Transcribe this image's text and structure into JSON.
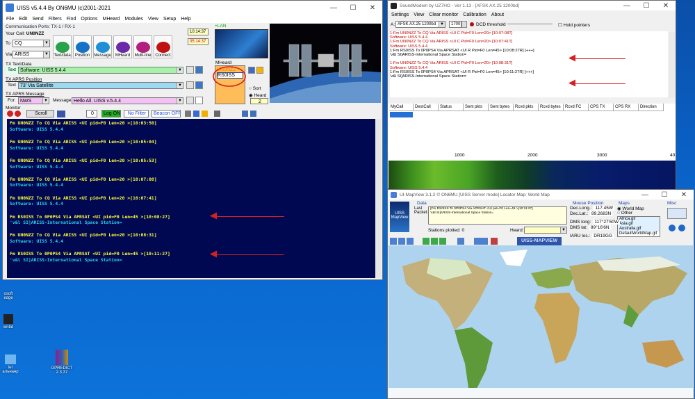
{
  "uiss": {
    "title": "UISS v5.4.4 By ON6MU (c)2001-2021",
    "menu": [
      "File",
      "Edit",
      "Send",
      "Filters",
      "Find",
      "Options",
      "MHeard",
      "Modules",
      "View",
      "Setup",
      "Help"
    ],
    "comm_ports": "Communication Ports: TX-1 / RX-1",
    "your_call_label": "Your Call:",
    "your_call": "UN0NZZ",
    "to_label": "To",
    "to_value": "CQ",
    "via_label": "Via",
    "via_value": "ARISS",
    "lan": "+LAN",
    "clock1": "10:14:37",
    "clock2": "05:14:37",
    "tool_buttons": [
      {
        "label": "Text/data",
        "icon": "text-data-icon",
        "color": "#2aa14b"
      },
      {
        "label": "Position",
        "icon": "position-icon",
        "color": "#1572c8"
      },
      {
        "label": "Message",
        "icon": "message-icon",
        "color": "#1f8fd6"
      },
      {
        "label": "MHeard",
        "icon": "mheard-icon",
        "color": "#6a2aa8"
      },
      {
        "label": "Multi-line",
        "icon": "multiline-icon",
        "color": "#b21f7c"
      },
      {
        "label": "Connect",
        "icon": "connect-icon",
        "color": "#c01212"
      }
    ],
    "tx_text_label": "TX Text/Data",
    "tx_text_prefix": "Text",
    "tx_text_value": "Software: UISS 5.4.4",
    "tx_pos_label": "TX APRS Position",
    "tx_pos_prefix": "Text",
    "tx_pos_value": "73' Via Satellite",
    "tx_msg_label": "TX APRS Message",
    "tx_msg_for_label": "For:",
    "tx_msg_for": "NWS",
    "tx_msg_message_label": "Message:",
    "tx_msg_value": "Hello All. UISS v.5.4.4",
    "mheard_label": "MHeard",
    "mheard_entries": [
      "UN0NZZ",
      "RS0ISS"
    ],
    "sort_label": "Sort",
    "heard_label": "Heard",
    "heard_count": "2",
    "monitor_label": "Monitor",
    "monitor_toolbar": {
      "scroll": "Scroll",
      "count": "0",
      "logon": "Log ON",
      "nofilter": "No Filter",
      "beacon": "Beacon OFF"
    },
    "monitor_lines": [
      {
        "text": "Fm UN0NZZ To CQ Via ARISS <UI pid=F0 Len=20 >[10:03:50]",
        "cls": "yel"
      },
      {
        "text": "Software: UISS 5.4.4",
        "cls": "cy"
      },
      {
        "text": "Fm UN0NZZ To CQ Via ARISS <UI pid=F0 Len=20 >[10:05:04]",
        "cls": "yel"
      },
      {
        "text": "Software: UISS 5.4.4",
        "cls": "cy"
      },
      {
        "text": "Fm UN0NZZ To CQ Via ARISS <UI pid=F0 Len=20 >[10:05:53]",
        "cls": "yel"
      },
      {
        "text": "Software: UISS 5.4.4",
        "cls": "cy"
      },
      {
        "text": "Fm UN0NZZ To CQ Via ARISS <UI pid=F0 Len=20 >[10:07:08]",
        "cls": "yel"
      },
      {
        "text": "Software: UISS 5.4.4",
        "cls": "cy"
      },
      {
        "text": "Fm UN0NZZ To CQ Via ARISS <UI pid=F0 Len=20 >[10:07:41]",
        "cls": "yel"
      },
      {
        "text": "Software: UISS 5.4.4",
        "cls": "cy"
      },
      {
        "text": "Fm RS0ISS To 0P0PS4 Via APRSAT <UI pid=F0 Len=45 >[10:08:27]",
        "cls": "yel"
      },
      {
        "text": "'v&l SI]ARISS-International Space Station=",
        "cls": "cy"
      },
      {
        "text": "Fm UN0NZZ To CQ Via ARISS <UI pid=F0 Len=20 >[10:08:31]",
        "cls": "yel"
      },
      {
        "text": "Software: UISS 5.4.4",
        "cls": "cy"
      },
      {
        "text": "Fm RS0ISS To 0P0PS4 Via APRSAT <UI pid=F0 Len=45 >[10:11:27]",
        "cls": "yel"
      },
      {
        "text": "'v&l SI]ARISS-International Space Station=",
        "cls": "cy"
      }
    ]
  },
  "soundmodem": {
    "title": "SoundModem by UZ7HO - Ver 1.13 - [AFSK AX.25 1200bd]",
    "menu": [
      "Settings",
      "View",
      "Clear monitor",
      "Calibration",
      "About"
    ],
    "channel": "A:",
    "mode": "AFSK AX.25 1200bd",
    "freq": "1700",
    "dcd_label": "DCD threshold",
    "hold_label": "Hold pointers",
    "lines": [
      {
        "text": "1:Fm UN0NZZ To CQ Via ARISS <UI C Pid=F0 Len=20> [10:07:08T]",
        "cls": "red"
      },
      {
        "text": "Software: UISS 5.4.4",
        "cls": "red"
      },
      {
        "text": "1:Fm UN0NZZ To CQ Via ARISS <UI C Pid=F0 Len=20> [10:07:41T]",
        "cls": "red"
      },
      {
        "text": "Software: UISS 5.4.4",
        "cls": "red"
      },
      {
        "text": "1:Fm RS0ISS To 0P0PS4 Via APRSAT <UI R Pid=F0 Len=45> [10:08:27R] [+++]",
        "cls": ""
      },
      {
        "text": "'v&l SI]ARISS-International Space Station=",
        "cls": ""
      },
      {
        "text": "",
        "cls": ""
      },
      {
        "text": "1:Fm UN0NZZ To CQ Via ARISS <UI C Pid=F0 Len=20> [10:08:31T]",
        "cls": "red"
      },
      {
        "text": "Software: UISS 5.4.4",
        "cls": "red"
      },
      {
        "text": "1:Fm RS0ISS To 0P0PS4 Via APRSAT <UI R Pid=F0 Len=45> [10:11:27R] [+++]",
        "cls": ""
      },
      {
        "text": "'v&l SI]ARISS-International Space Station=",
        "cls": ""
      }
    ],
    "columns": [
      "MyCall",
      "DestCall",
      "Status",
      "Sent pkts",
      "Sent bytes",
      "Rcvd pkts",
      "Rcvd bytes",
      "Rcvd FC",
      "CPS TX",
      "CPS RX",
      "Direction"
    ],
    "scale": [
      "1000",
      "2000",
      "3000",
      "40"
    ]
  },
  "mapview": {
    "title": "UI-MapView 3.1.2 © ON6MU  [UISS Server mode]  Locator Map: World Map",
    "data_label": "Data",
    "last_packet_label": "Last Packet:",
    "last_packet": "[Fm RS0ISS To 0P0PS4 Via APRSAT <UI pid=F0 Len=45 >[10:11:27]\n'v&l SI]ARISS-International Space Station=",
    "stations_label": "Stations plotted:",
    "stations": "0",
    "heard_label": "Heard:",
    "mouse_label": "Mouse Position",
    "dec_long_label": "Dec.Long.:",
    "dec_long": "117.45W",
    "dec_lat_label": "Dec.Lat.:",
    "dec_lat": "89.2683N",
    "dms_long_label": "DMS long:",
    "dms_long": "117°27'60W",
    "dms_lat_label": "DMS lat:",
    "dms_lat": "89°16'6N",
    "iaru_label": "IARU loc.:",
    "iaru": "DR19GG",
    "maps_label": "Maps",
    "maps_opt1": "World Map",
    "maps_opt2": "Other",
    "map_files": [
      "Africa.gif",
      "Asia.gif",
      "Australia.gif",
      "DefaultWorldMap.gif"
    ],
    "misc_label": "Misc",
    "banner": "UISS-MAPVIEW",
    "logo": "UISS MapView"
  },
  "desktop": {
    "icons": [
      {
        "label": "osoft\nedge"
      },
      {
        "label": "wnbd"
      },
      {
        "label": "GPREDICT\n2.3.37"
      },
      {
        "label": "ter\nальнанр"
      }
    ]
  }
}
